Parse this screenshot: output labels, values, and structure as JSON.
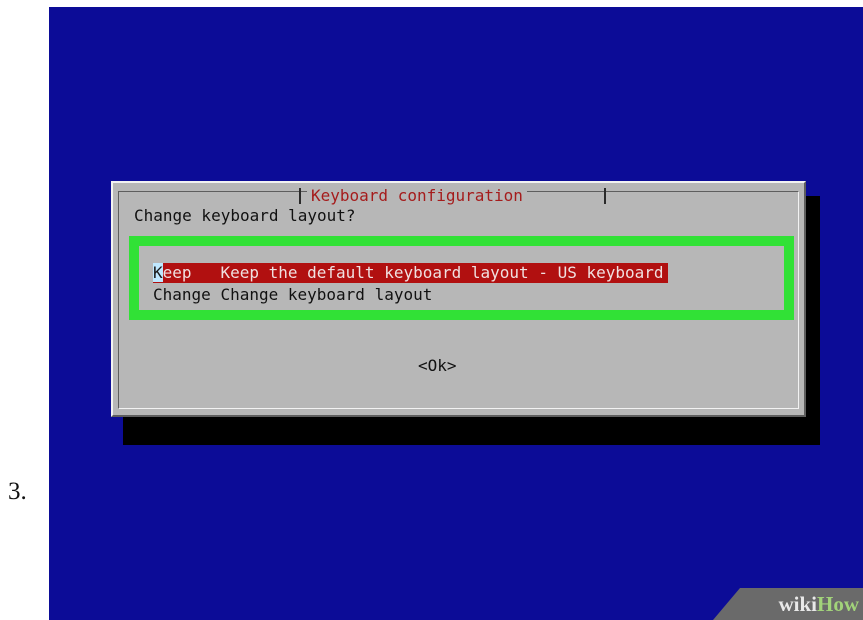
{
  "step_number": "3.",
  "dialog": {
    "title": "Keyboard configuration",
    "prompt": "Change keyboard layout?",
    "options": [
      {
        "key": "Keep",
        "description": "Keep the default keyboard layout - US keyboard",
        "selected": true
      },
      {
        "key": "Change",
        "description": "Change keyboard layout",
        "selected": false
      }
    ],
    "ok_button": "<Ok>"
  },
  "watermark": {
    "part1": "wiki",
    "part2": "How"
  },
  "colors": {
    "screen_background": "#0c0c97",
    "dialog_background": "#b7b7b7",
    "title_text": "#a51c1c",
    "selection_background": "#b11010",
    "highlight_frame": "#31e136",
    "cursor": "#bfe8ff"
  }
}
